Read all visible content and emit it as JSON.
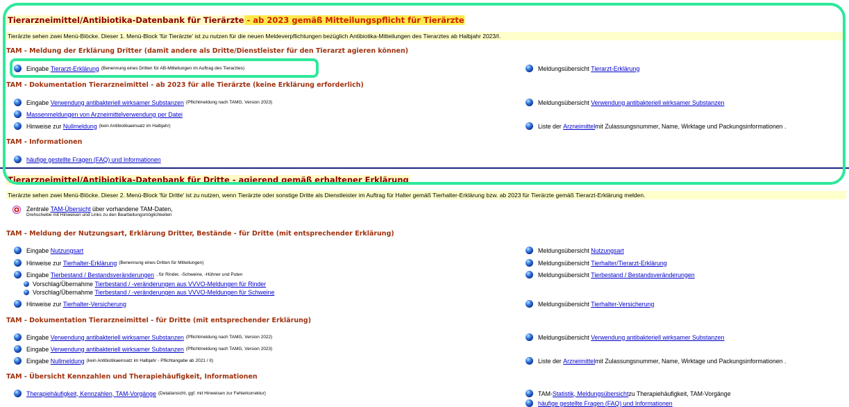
{
  "block1": {
    "title_a": "Tierarzneimittel/Antibiotika-Datenbank für Tierärzte",
    "title_b": " - ab 2023 gemäß Mitteilungspflicht für Tierärzte",
    "info": "Tierärzte sehen zwei Menü-Blöcke. Dieser 1. Menü-Block 'für Tierärzte' ist zu nutzen für die neuen Meldeverpflichtungen bezüglich Antibiotika-Mitteilungen des Tierarztes ab Halbjahr 2023/I.",
    "sec1": "TAM - Meldung der Erklärung Dritter (damit andere als Dritte/Dienstleister für den Tierarzt agieren können)",
    "r1_prefix": "Eingabe ",
    "r1_link": "Tierarzt-Erklärung",
    "r1_note": "(Benennung eines Dritten für AB-Mitteilungen im Auftrag des Tierarztes)",
    "r1_right_prefix": "Meldungsübersicht ",
    "r1_right_link": "Tierarzt-Erklärung",
    "sec2": "TAM - Dokumentation Tierarzneimittel - ab 2023 für alle Tierärzte (keine Erklärung erforderlich)",
    "r2_prefix": "Eingabe ",
    "r2_link": "Verwendung antibakteriell wirksamer Substanzen",
    "r2_note": "(Pflichtmeldung nach TAMG, Version 2023)",
    "r2_right_prefix": "Meldungsübersicht ",
    "r2_right_link": "Verwendung antibakteriell wirksamer Substanzen",
    "r3_link": "Massenmeldungen von Arzneimittelverwendung per Datei",
    "r4_prefix": "Hinweise zur ",
    "r4_link": "Nullmeldung",
    "r4_note": "(kein Antibiotikaeinsatz im Halbjahr)",
    "r4_right_prefix": "Liste der ",
    "r4_right_link": "Arzneimittel",
    "r4_right_suffix": " mit Zulassungsnummer, Name, Wirktage und Packungsinformationen .",
    "sec3": "TAM - Informationen",
    "r5_link": "häufige gestellte Fragen (FAQ) und Informationen"
  },
  "block2": {
    "title": "Tierarzneimittel/Antibiotika-Datenbank für Dritte - agierend gemäß erhaltener Erklärung",
    "info": "Tierärzte sehen zwei Menü-Blöcke. Dieser 2. Menü-Block 'für Dritte' ist zu nutzen, wenn Tierärzte oder sonstige Dritte als Dienstleister im Auftrag für Halter gemäß Tierhalter-Erklärung bzw. ab 2023 für Tierärzte gemäß Tierarzt-Erklärung melden.",
    "central_prefix": "Zentrale ",
    "central_link": "TAM-Übersicht",
    "central_suffix": " über vorhandene TAM-Daten,",
    "central_note": "Drehscheibe mit Hinweisen und Links zu den Bearbeitungsmöglichkeiten",
    "sec1": "TAM - Meldung der Nutzungsart, Erklärung Dritter, Bestände - für Dritte (mit entsprechender Erklärung)",
    "n1_prefix": "Eingabe ",
    "n1_link": "Nutzungsart",
    "n1_right_prefix": "Meldungsübersicht ",
    "n1_right_link": "Nutzungsart",
    "n2_prefix": "Hinweise zur ",
    "n2_link": "Tierhalter-Erklärung",
    "n2_note": "(Benennung eines Dritten für Mitteilungen)",
    "n2_right_prefix": "Meldungsübersicht ",
    "n2_right_link": "Tierhalter/Tierarzt-Erklärung",
    "n3_prefix": "Eingabe ",
    "n3_link": "Tierbestand / Bestandsveränderungen",
    "n3_note": ", für Rinder, -Schweine, -Hühner und Puten",
    "n3_right_prefix": "Meldungsübersicht ",
    "n3_right_link": "Tierbestand / Bestandsveränderungen",
    "n3a_prefix": "Vorschlag/Übernahme ",
    "n3a_link": "Tierbestand / -veränderungen aus VVVO-Meldungen für Rinder",
    "n3b_prefix": "Vorschlag/Übernahme ",
    "n3b_link": "Tierbestand / -veränderungen aus VVVO-Meldungen für Schweine",
    "n4_prefix": "Hinweise zur ",
    "n4_link": "Tierhalter-Versicherung",
    "n4_right_prefix": "Meldungsübersicht ",
    "n4_right_link": "Tierhalter-Versicherung",
    "sec2": "TAM - Dokumentation Tierarzneimittel - für Dritte (mit entsprechender Erklärung)",
    "d1_prefix": "Eingabe ",
    "d1_link": "Verwendung antibakteriell wirksamer Substanzen",
    "d1_note": "(Pflichtmeldung nach TAMG, Version 2022)",
    "d1_right_prefix": "Meldungsübersicht ",
    "d1_right_link": "Verwendung antibakteriell wirksamer Substanzen",
    "d2_prefix": "Eingabe ",
    "d2_link": "Verwendung antibakteriell wirksamer Substanzen",
    "d2_note": "(Pflichtmeldung nach TAMG, Version 2023)",
    "d3_prefix": "Eingabe ",
    "d3_link": "Nullmeldung",
    "d3_note": "(kein Antibiotikaeinsatz im Halbjahr - Pflichtangabe ab 2021 / II)",
    "d3_right_prefix": "Liste der ",
    "d3_right_link": "Arzneimittel",
    "d3_right_suffix": " mit Zulassungsnummer, Name, Wirktage und Packungsinformationen .",
    "sec3": "TAM - Übersicht Kennzahlen und Therapiehäufigkeit, Informationen",
    "k1_link": "Therapiehäufigkeit, Kennzahlen, TAM-Vorgänge",
    "k1_note": "(Detailansicht, ggf. mit Hinweisen zur Fehlerkorrektur)",
    "k1_right_prefix": "TAM-",
    "k1_right_link": "Statistik, Meldungsübersicht",
    "k1_right_suffix": " zu Therapiehäufigkeit, TAM-Vorgänge",
    "k2_right_link": "häufige gestellte Fragen (FAQ) und Informationen"
  },
  "colors": {
    "highlight": "#2ee89b",
    "link": "#0000cc",
    "section": "#a0320f",
    "title": "#8b0000"
  }
}
